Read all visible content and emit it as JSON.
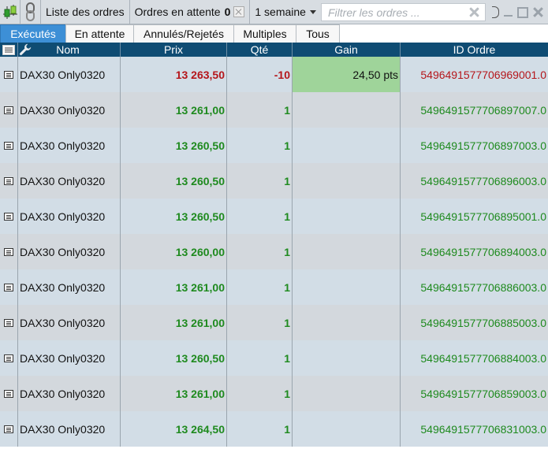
{
  "toolbar": {
    "orders_list_label": "Liste des ordres",
    "pending_label": "Ordres en attente",
    "pending_count": "0",
    "period_value": "1 semaine",
    "filter_placeholder": "Filtrer les ordres ...",
    "truncated_label": "D"
  },
  "tabs": [
    {
      "label": "Exécutés",
      "active": true
    },
    {
      "label": "En attente",
      "active": false
    },
    {
      "label": "Annulés/Rejetés",
      "active": false
    },
    {
      "label": "Multiples",
      "active": false
    },
    {
      "label": "Tous",
      "active": false
    }
  ],
  "columns": {
    "nom": "Nom",
    "prix": "Prix",
    "qte": "Qté",
    "gain": "Gain",
    "id": "ID Ordre"
  },
  "rows": [
    {
      "name": "DAX30 Only0320",
      "prix": "13 263,50",
      "qte": "-10",
      "gain": "24,50 pts",
      "id": "5496491577706969001.0",
      "side": "sell"
    },
    {
      "name": "DAX30 Only0320",
      "prix": "13 261,00",
      "qte": "1",
      "gain": "",
      "id": "5496491577706897007.0",
      "side": "buy"
    },
    {
      "name": "DAX30 Only0320",
      "prix": "13 260,50",
      "qte": "1",
      "gain": "",
      "id": "5496491577706897003.0",
      "side": "buy"
    },
    {
      "name": "DAX30 Only0320",
      "prix": "13 260,50",
      "qte": "1",
      "gain": "",
      "id": "5496491577706896003.0",
      "side": "buy"
    },
    {
      "name": "DAX30 Only0320",
      "prix": "13 260,50",
      "qte": "1",
      "gain": "",
      "id": "5496491577706895001.0",
      "side": "buy"
    },
    {
      "name": "DAX30 Only0320",
      "prix": "13 260,00",
      "qte": "1",
      "gain": "",
      "id": "5496491577706894003.0",
      "side": "buy"
    },
    {
      "name": "DAX30 Only0320",
      "prix": "13 261,00",
      "qte": "1",
      "gain": "",
      "id": "5496491577706886003.0",
      "side": "buy"
    },
    {
      "name": "DAX30 Only0320",
      "prix": "13 261,00",
      "qte": "1",
      "gain": "",
      "id": "5496491577706885003.0",
      "side": "buy"
    },
    {
      "name": "DAX30 Only0320",
      "prix": "13 260,50",
      "qte": "1",
      "gain": "",
      "id": "5496491577706884003.0",
      "side": "buy"
    },
    {
      "name": "DAX30 Only0320",
      "prix": "13 261,00",
      "qte": "1",
      "gain": "",
      "id": "5496491577706859003.0",
      "side": "buy"
    },
    {
      "name": "DAX30 Only0320",
      "prix": "13 264,50",
      "qte": "1",
      "gain": "",
      "id": "5496491577706831003.0",
      "side": "buy"
    }
  ],
  "colors": {
    "buy": "#1e8a1e",
    "sell": "#b5161b",
    "gain_positive_bg": "#9fd49a",
    "header_bg": "#0f4c73",
    "active_tab_bg": "#3d8fd6"
  }
}
